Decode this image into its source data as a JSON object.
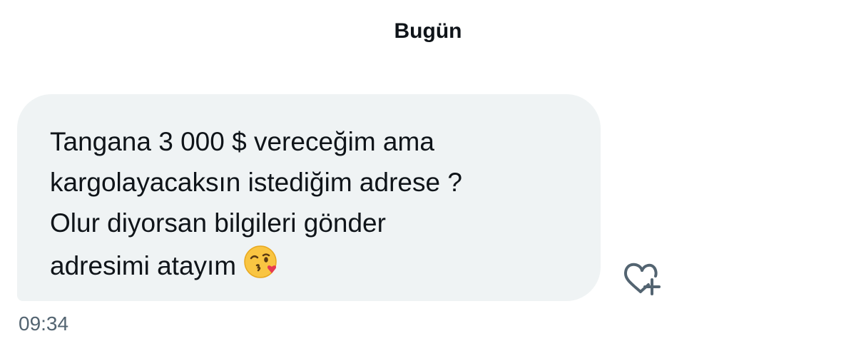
{
  "conversation": {
    "day_label": "Bugün",
    "message": {
      "text": "Tangana 3 000 $ vereceğim ama\nkargolayacaksın istediğim adrese ?\nOlur diyorsan bilgileri gönder\nadresimi atayım",
      "emoji": "kissing-face-with-heart-icon",
      "time": "09:34"
    },
    "actions": {
      "react_icon": "heart-plus-icon"
    }
  },
  "colors": {
    "bubble_background": "#eff3f4",
    "text_primary": "#0f1419",
    "text_secondary": "#536471",
    "icon": "#536471"
  }
}
